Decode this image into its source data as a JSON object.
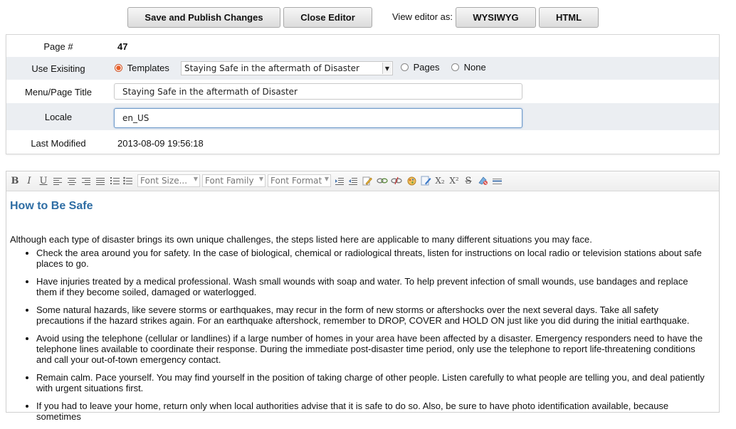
{
  "toolbar_top": {
    "save_label": "Save and Publish Changes",
    "close_label": "Close Editor",
    "view_label": "View editor as:",
    "wysiwyg_label": "WYSIWYG",
    "html_label": "HTML"
  },
  "form": {
    "page_label": "Page #",
    "page_value": "47",
    "use_existing_label": "Use Exisiting",
    "templates_label": "Templates",
    "template_selected": "Staying Safe in the aftermath of Disaster",
    "pages_label": "Pages",
    "none_label": "None",
    "menu_title_label": "Menu/Page Title",
    "menu_title_value": "Staying Safe in the aftermath of Disaster",
    "locale_label": "Locale",
    "locale_value": "en_US",
    "last_modified_label": "Last Modified",
    "last_modified_value": "2013-08-09 19:56:18"
  },
  "editor_toolbar": {
    "bold": "B",
    "italic": "I",
    "underline": "U",
    "font_size": "Font Size...",
    "font_family": "Font Family",
    "font_format": "Font Format",
    "subscript": "X₂",
    "superscript": "X²",
    "strike": "S"
  },
  "content": {
    "heading": "How to Be Safe",
    "intro": "Although each type of disaster brings its own unique challenges, the steps listed here are applicable to many different situations you may face.",
    "items": [
      "Check the area around you for safety. In the case of biological, chemical or radiological threats, listen for instructions on local radio or television stations about safe places to go.",
      "Have injuries treated by a medical professional. Wash small wounds with soap and water. To help prevent infection of small wounds, use bandages and replace them if they become soiled, damaged or waterlogged.",
      "Some natural hazards, like severe storms or earthquakes, may recur in the form of new storms or aftershocks over the next several days. Take all safety precautions if the hazard strikes again. For an earthquake aftershock, remember to DROP, COVER and HOLD ON just like you did during the initial earthquake.",
      "Avoid using the telephone (cellular or landlines) if a large number of homes in your area have been affected by a disaster. Emergency responders need to have the telephone lines available to coordinate their response. During the immediate post-disaster time period, only use the telephone to report life-threatening conditions and call your out-of-town emergency contact.",
      "Remain calm. Pace yourself. You may find yourself in the position of taking charge of other people. Listen carefully to what people are telling you, and deal patiently with urgent situations first.",
      "If you had to leave your home, return only when local authorities advise that it is safe to do so. Also, be sure to have photo identification available, because sometimes"
    ]
  }
}
